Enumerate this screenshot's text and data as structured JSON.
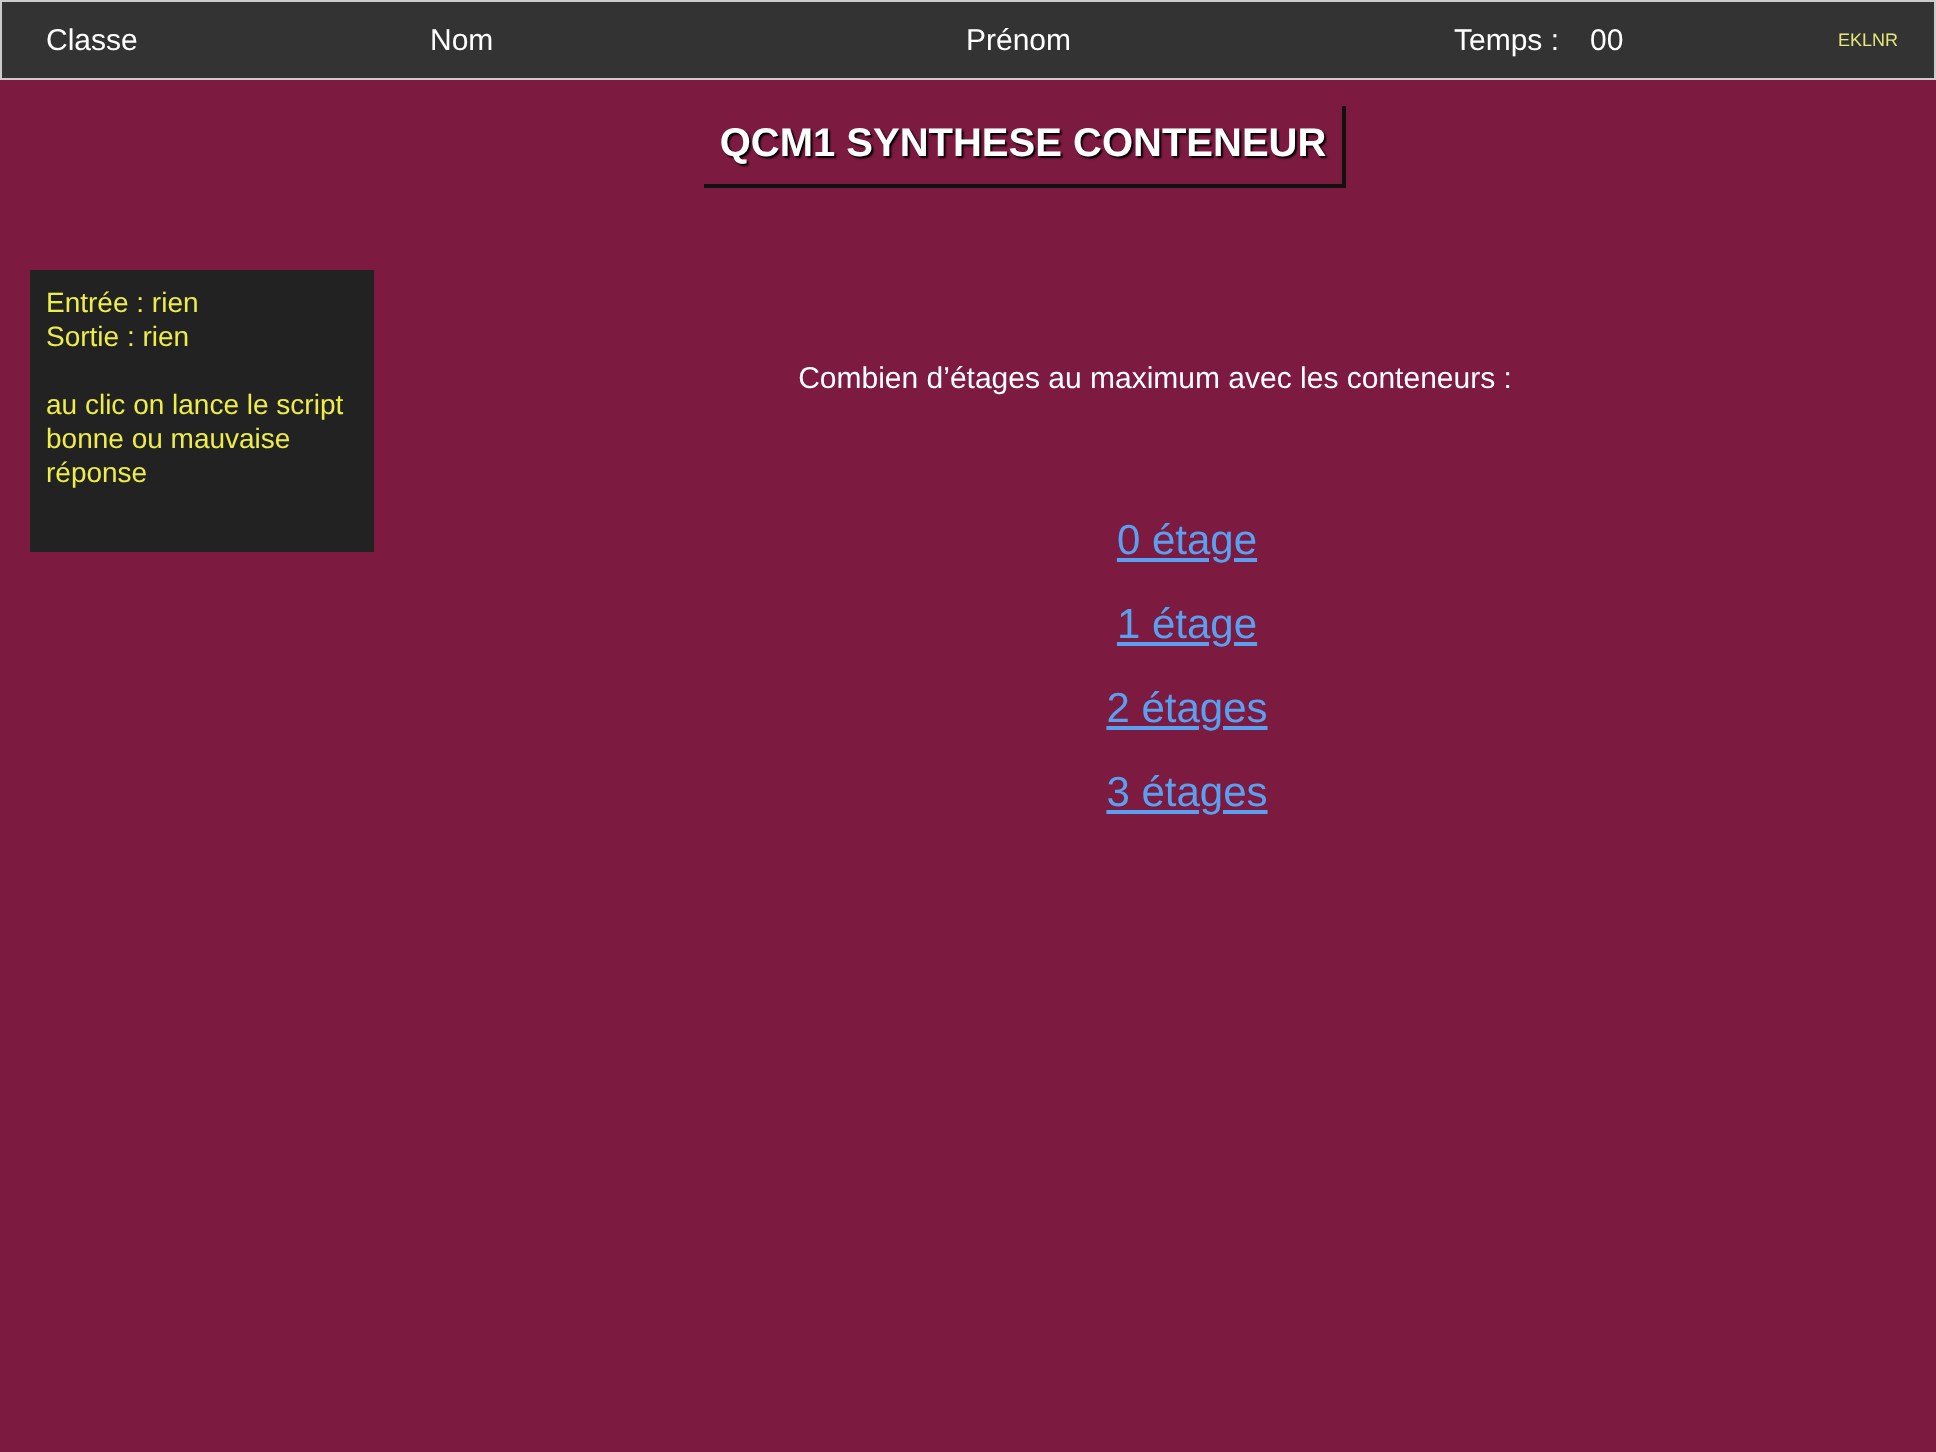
{
  "header": {
    "fields": [
      {
        "label": "Classe"
      },
      {
        "label": "Nom"
      },
      {
        "label": "Prénom"
      },
      {
        "label": "Temps :"
      }
    ],
    "timer": "00",
    "code": "EKLNR"
  },
  "title": "QCM1 SYNTHESE CONTENEUR",
  "note": {
    "lines": [
      "Entrée : rien",
      "Sortie : rien"
    ],
    "paragraph": "au clic on lance le script bonne ou mauvaise réponse"
  },
  "question": "Combien d’étages au maximum avec les conteneurs :",
  "answers": [
    "0 étage",
    "1 étage",
    "2 étages",
    "3 étages"
  ]
}
